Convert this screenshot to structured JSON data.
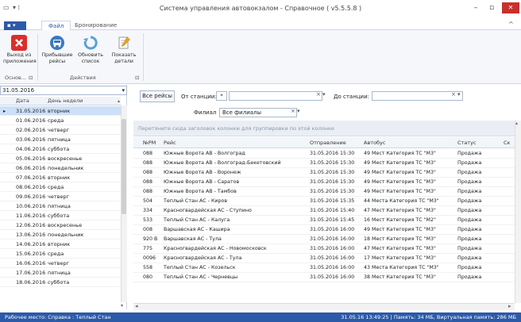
{
  "window": {
    "title": "Система управления автовокзалом - Справочное ( v5.5.5.8 )",
    "quick_access": "▾ ⁞",
    "menu_glyph": "▭",
    "min": "–",
    "max": "▫",
    "close": "✕",
    "ribbon_collapse": "^"
  },
  "ribbon": {
    "file_menu": "▪ ▾",
    "tabs": [
      "Файл",
      "Бронирование"
    ],
    "buttons": [
      {
        "label1": "Выход из",
        "label2": "приложения",
        "icon": "exit-icon",
        "color": "#d9302a"
      },
      {
        "label1": "Прибывшие",
        "label2": "рейсы",
        "icon": "bus-arrive-icon",
        "color": "#3a78c2"
      },
      {
        "label1": "Обновить",
        "label2": "список",
        "icon": "refresh-icon",
        "color": "#5aa0d8"
      },
      {
        "label1": "Показать",
        "label2": "детали",
        "icon": "details-icon",
        "color": "#e0a032"
      }
    ],
    "groups": [
      "Основ...",
      "Действия"
    ],
    "group_launcher": "⊡"
  },
  "left": {
    "date": "31.05.2016",
    "date_dropdown": "▾",
    "col_date": "Дата",
    "col_day": "День недели",
    "scroll_up": "▴",
    "scroll_down": "▾",
    "current_marker": "▸",
    "rows": [
      [
        "31.05.2016",
        "вторник"
      ],
      [
        "01.06.2016",
        "среда"
      ],
      [
        "02.06.2016",
        "четверг"
      ],
      [
        "03.06.2016",
        "пятница"
      ],
      [
        "04.06.2016",
        "суббота"
      ],
      [
        "05.06.2016",
        "воскресенье"
      ],
      [
        "06.06.2016",
        "понедельник"
      ],
      [
        "07.06.2016",
        "вторник"
      ],
      [
        "08.06.2016",
        "среда"
      ],
      [
        "09.06.2016",
        "четверг"
      ],
      [
        "10.06.2016",
        "пятница"
      ],
      [
        "11.06.2016",
        "суббота"
      ],
      [
        "12.06.2016",
        "воскресенье"
      ],
      [
        "13.06.2016",
        "понедельник"
      ],
      [
        "14.06.2016",
        "вторник"
      ],
      [
        "15.06.2016",
        "среда"
      ],
      [
        "16.06.2016",
        "четверг"
      ],
      [
        "17.06.2016",
        "пятница"
      ],
      [
        "18.06.2016",
        "суббота"
      ]
    ]
  },
  "filters": {
    "all_trips": "Все рейсы",
    "from_label": "От станции:",
    "from_value": "*",
    "to_label": "До станции:",
    "branch_label": "Филиал",
    "branch_value": "Все филиалы",
    "clear": "×",
    "dropdown": "▾"
  },
  "grid": {
    "group_hint": "Перетяните сюда заголовок колонки для группировки по этой колонке",
    "columns": [
      "№РМ",
      "Рейс",
      "Отправление",
      "Автобус",
      "Статус",
      "Ск"
    ],
    "scroll_up": "▴",
    "scroll_left": "◂",
    "scroll_right": "▸",
    "rows": [
      [
        "088",
        "Южные Ворота АВ - Волгоград",
        "31.05.2016 15:30",
        "49 Мест Категория ТС \"М3\"",
        "Продажа"
      ],
      [
        "088",
        "Южные Ворота АВ - Волгоград-Бекетовский",
        "31.05.2016 15:30",
        "49 Мест Категория ТС \"М3\"",
        "Продажа"
      ],
      [
        "088",
        "Южные Ворота АВ - Воронеж",
        "31.05.2016 15:30",
        "49 Мест Категория ТС \"М3\"",
        "Продажа"
      ],
      [
        "088",
        "Южные Ворота АВ - Саратов",
        "31.05.2016 15:30",
        "49 Мест Категория ТС \"М3\"",
        "Продажа"
      ],
      [
        "088",
        "Южные Ворота АВ - Тамбов",
        "31.05.2016 15:30",
        "49 Мест Категория ТС \"М3\"",
        "Продажа"
      ],
      [
        "504",
        "Теплый Стан АС - Киров",
        "31.05.2016 15:35",
        "44 Места Категория ТС \"М3\"",
        "Продажа"
      ],
      [
        "334",
        "Красногвардейская АС - Ступино",
        "31.05.2016 15:40",
        "47 Мест Категория ТС \"М3\"",
        "Продажа"
      ],
      [
        "533",
        "Теплый Стан АС - Калуга",
        "31.05.2016 15:45",
        "16 Мест Категория ТС \"М2\"",
        "Продажа"
      ],
      [
        "008",
        "Варшавская АС - Кашира",
        "31.05.2016 16:00",
        "49 Мест Категория ТС \"М3\"",
        "Продажа"
      ],
      [
        "920 В",
        "Варшавская АС - Тула",
        "31.05.2016 16:00",
        "18 Мест Категория ТС \"М3\"",
        "Продажа"
      ],
      [
        "775",
        "Красногвардейская АС - Новомосковск",
        "31.05.2016 16:00",
        "47 Мест Категория ТС \"М3\"",
        "Продажа"
      ],
      [
        "0096",
        "Красногвардейская АС - Тула",
        "31.05.2016 16:00",
        "17 Мест Категория ТС \"М3\"",
        "Продажа"
      ],
      [
        "558",
        "Теплый Стан АС - Козельск",
        "31.05.2016 16:00",
        "43 Места Категория ТС \"М3\"",
        "Продажа"
      ],
      [
        "080",
        "Теплый Стан АС - Черневцы",
        "31.05.2016 16:00",
        "38 Мест Категория ТС \"М3\"",
        "Продажа"
      ]
    ]
  },
  "status": {
    "workplace": "Рабочее место: Справка : Теплый Стан",
    "info": "31.05.16 13:49:25 | Память: 34 МБ, Виртуальная память: 286 МБ"
  }
}
